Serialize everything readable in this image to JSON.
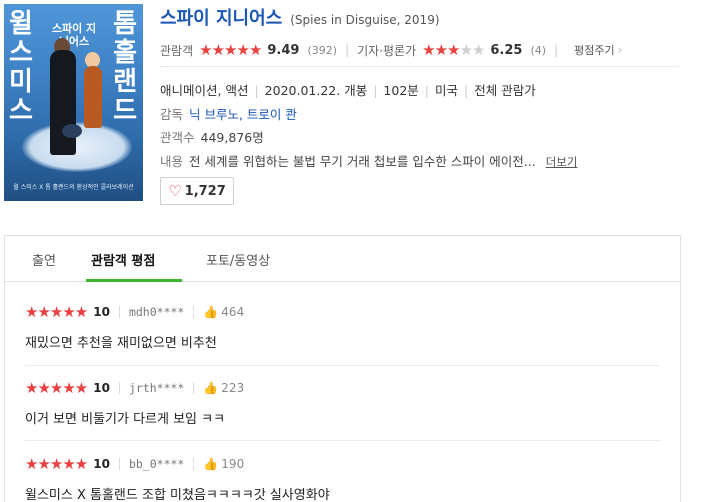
{
  "poster": {
    "title_left": "윌 스미스",
    "title_right": "톰 홀랜드",
    "title_center": "스파이 지니어스",
    "caption": "월 스미스 X 톰 홀랜드의 환상적인 콜라보레이션"
  },
  "movie": {
    "title": "스파이 지니어스",
    "original_title": "(Spies in Disguise, 2019)",
    "audience_label": "관람객",
    "audience_score": "9.49",
    "audience_count": "(392)",
    "audience_stars": 5,
    "critic_label": "기자·평론가",
    "critic_score": "6.25",
    "critic_count": "(4)",
    "critic_stars": 3,
    "more_eval_label": "평점주기",
    "genre": "애니메이션, 액션",
    "release": "2020.01.22. 개봉",
    "runtime": "102분",
    "country": "미국",
    "rating": "전체 관람가",
    "director_label": "감독",
    "directors": "닉 브루노, 트로이 콴",
    "audience_total_label": "관객수",
    "audience_total": "449,876명",
    "summary_label": "내용",
    "summary": "전 세계를 위협하는 불법 무기 거래 첩보를 입수한 스파이 에이전...",
    "more_label": "더보기",
    "like_count": "1,727"
  },
  "tabs": [
    {
      "label": "출연"
    },
    {
      "label": "관람객 평점"
    },
    {
      "label": "포토/동영상"
    }
  ],
  "reviews": [
    {
      "stars": 5,
      "score": "10",
      "user": "mdh0****",
      "likes": "464",
      "text": "재밌으면 추천을 재미없으면 비추천"
    },
    {
      "stars": 5,
      "score": "10",
      "user": "jrth****",
      "likes": "223",
      "text": "이거 보면 비둘기가 다르게 보임 ㅋㅋ"
    },
    {
      "stars": 5,
      "score": "10",
      "user": "bb_0****",
      "likes": "190",
      "text": "윌스미스 X 톰홀랜드 조합 미쳤음ㅋㅋㅋㅋ갓 실사영화야"
    }
  ],
  "colors": {
    "accent_red": "#e8413f",
    "title_blue": "#1a56b5",
    "tab_green": "#3bb533"
  }
}
